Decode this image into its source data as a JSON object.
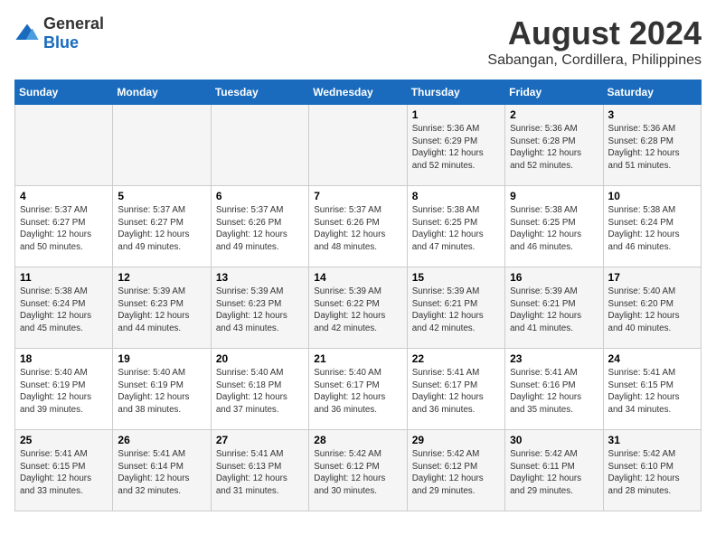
{
  "logo": {
    "general": "General",
    "blue": "Blue"
  },
  "title": "August 2024",
  "subtitle": "Sabangan, Cordillera, Philippines",
  "weekdays": [
    "Sunday",
    "Monday",
    "Tuesday",
    "Wednesday",
    "Thursday",
    "Friday",
    "Saturday"
  ],
  "weeks": [
    [
      {
        "day": "",
        "info": ""
      },
      {
        "day": "",
        "info": ""
      },
      {
        "day": "",
        "info": ""
      },
      {
        "day": "",
        "info": ""
      },
      {
        "day": "1",
        "info": "Sunrise: 5:36 AM\nSunset: 6:29 PM\nDaylight: 12 hours\nand 52 minutes."
      },
      {
        "day": "2",
        "info": "Sunrise: 5:36 AM\nSunset: 6:28 PM\nDaylight: 12 hours\nand 52 minutes."
      },
      {
        "day": "3",
        "info": "Sunrise: 5:36 AM\nSunset: 6:28 PM\nDaylight: 12 hours\nand 51 minutes."
      }
    ],
    [
      {
        "day": "4",
        "info": "Sunrise: 5:37 AM\nSunset: 6:27 PM\nDaylight: 12 hours\nand 50 minutes."
      },
      {
        "day": "5",
        "info": "Sunrise: 5:37 AM\nSunset: 6:27 PM\nDaylight: 12 hours\nand 49 minutes."
      },
      {
        "day": "6",
        "info": "Sunrise: 5:37 AM\nSunset: 6:26 PM\nDaylight: 12 hours\nand 49 minutes."
      },
      {
        "day": "7",
        "info": "Sunrise: 5:37 AM\nSunset: 6:26 PM\nDaylight: 12 hours\nand 48 minutes."
      },
      {
        "day": "8",
        "info": "Sunrise: 5:38 AM\nSunset: 6:25 PM\nDaylight: 12 hours\nand 47 minutes."
      },
      {
        "day": "9",
        "info": "Sunrise: 5:38 AM\nSunset: 6:25 PM\nDaylight: 12 hours\nand 46 minutes."
      },
      {
        "day": "10",
        "info": "Sunrise: 5:38 AM\nSunset: 6:24 PM\nDaylight: 12 hours\nand 46 minutes."
      }
    ],
    [
      {
        "day": "11",
        "info": "Sunrise: 5:38 AM\nSunset: 6:24 PM\nDaylight: 12 hours\nand 45 minutes."
      },
      {
        "day": "12",
        "info": "Sunrise: 5:39 AM\nSunset: 6:23 PM\nDaylight: 12 hours\nand 44 minutes."
      },
      {
        "day": "13",
        "info": "Sunrise: 5:39 AM\nSunset: 6:23 PM\nDaylight: 12 hours\nand 43 minutes."
      },
      {
        "day": "14",
        "info": "Sunrise: 5:39 AM\nSunset: 6:22 PM\nDaylight: 12 hours\nand 42 minutes."
      },
      {
        "day": "15",
        "info": "Sunrise: 5:39 AM\nSunset: 6:21 PM\nDaylight: 12 hours\nand 42 minutes."
      },
      {
        "day": "16",
        "info": "Sunrise: 5:39 AM\nSunset: 6:21 PM\nDaylight: 12 hours\nand 41 minutes."
      },
      {
        "day": "17",
        "info": "Sunrise: 5:40 AM\nSunset: 6:20 PM\nDaylight: 12 hours\nand 40 minutes."
      }
    ],
    [
      {
        "day": "18",
        "info": "Sunrise: 5:40 AM\nSunset: 6:19 PM\nDaylight: 12 hours\nand 39 minutes."
      },
      {
        "day": "19",
        "info": "Sunrise: 5:40 AM\nSunset: 6:19 PM\nDaylight: 12 hours\nand 38 minutes."
      },
      {
        "day": "20",
        "info": "Sunrise: 5:40 AM\nSunset: 6:18 PM\nDaylight: 12 hours\nand 37 minutes."
      },
      {
        "day": "21",
        "info": "Sunrise: 5:40 AM\nSunset: 6:17 PM\nDaylight: 12 hours\nand 36 minutes."
      },
      {
        "day": "22",
        "info": "Sunrise: 5:41 AM\nSunset: 6:17 PM\nDaylight: 12 hours\nand 36 minutes."
      },
      {
        "day": "23",
        "info": "Sunrise: 5:41 AM\nSunset: 6:16 PM\nDaylight: 12 hours\nand 35 minutes."
      },
      {
        "day": "24",
        "info": "Sunrise: 5:41 AM\nSunset: 6:15 PM\nDaylight: 12 hours\nand 34 minutes."
      }
    ],
    [
      {
        "day": "25",
        "info": "Sunrise: 5:41 AM\nSunset: 6:15 PM\nDaylight: 12 hours\nand 33 minutes."
      },
      {
        "day": "26",
        "info": "Sunrise: 5:41 AM\nSunset: 6:14 PM\nDaylight: 12 hours\nand 32 minutes."
      },
      {
        "day": "27",
        "info": "Sunrise: 5:41 AM\nSunset: 6:13 PM\nDaylight: 12 hours\nand 31 minutes."
      },
      {
        "day": "28",
        "info": "Sunrise: 5:42 AM\nSunset: 6:12 PM\nDaylight: 12 hours\nand 30 minutes."
      },
      {
        "day": "29",
        "info": "Sunrise: 5:42 AM\nSunset: 6:12 PM\nDaylight: 12 hours\nand 29 minutes."
      },
      {
        "day": "30",
        "info": "Sunrise: 5:42 AM\nSunset: 6:11 PM\nDaylight: 12 hours\nand 29 minutes."
      },
      {
        "day": "31",
        "info": "Sunrise: 5:42 AM\nSunset: 6:10 PM\nDaylight: 12 hours\nand 28 minutes."
      }
    ]
  ]
}
